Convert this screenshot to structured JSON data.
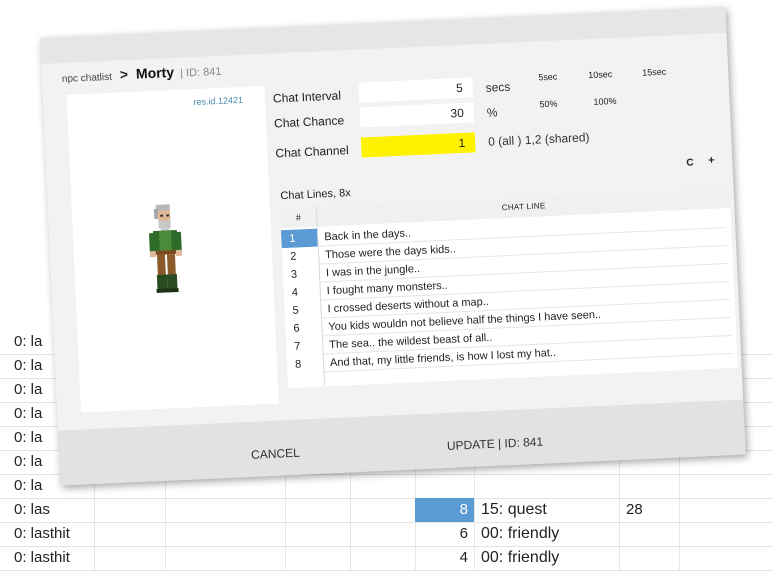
{
  "background_sheet": {
    "rows": [
      {
        "col0": "0: la",
        "num": "",
        "label": "",
        "count": ""
      },
      {
        "col0": "0: la",
        "num": "",
        "label": "",
        "count": ""
      },
      {
        "col0": "0: la",
        "num": "",
        "label": "",
        "count": ""
      },
      {
        "col0": "0: la",
        "num": "",
        "label": "",
        "count": ""
      },
      {
        "col0": "0: la",
        "num": "",
        "label": "",
        "count": ""
      },
      {
        "col0": "0: la",
        "num": "",
        "label": "",
        "count": ""
      },
      {
        "col0": "0: la",
        "num": "",
        "label": "",
        "count": ""
      },
      {
        "col0": "0: las",
        "num": "8",
        "label": "15: quest",
        "count": "28"
      },
      {
        "col0": "0: lasthit",
        "num": "6",
        "label": "00: friendly",
        "count": ""
      },
      {
        "col0": "0: lasthit",
        "num": "4",
        "label": "00: friendly",
        "count": ""
      }
    ],
    "selected_color": "#5b9bd5"
  },
  "dialog": {
    "breadcrumb": {
      "parent": "npc chatlist",
      "separator": ">",
      "name": "Morty",
      "id_text": "| ID: 841"
    },
    "portrait": {
      "res_id": "res.id.12421",
      "sprite_icon": "npc-old-man-sprite"
    },
    "fields": {
      "interval": {
        "label": "Chat Interval",
        "value": "5",
        "unit": "secs"
      },
      "chance": {
        "label": "Chat Chance",
        "value": "30",
        "unit": "%"
      },
      "channel": {
        "label": "Chat Channel",
        "value": "1",
        "hint": "0 (all ) 1,2 (shared)",
        "highlight_color": "#fff200"
      }
    },
    "interval_presets": [
      "5sec",
      "10sec",
      "15sec"
    ],
    "chance_presets": [
      "50%",
      "100%"
    ],
    "chat_lines": {
      "title": "Chat Lines, 8x",
      "c_button": "C",
      "add_button": "+",
      "header_num": "#",
      "header_line": "CHAT LINE",
      "selected_index": 0,
      "rows": [
        {
          "num": "1",
          "text": "Back in the days.."
        },
        {
          "num": "2",
          "text": "Those were the days kids.."
        },
        {
          "num": "3",
          "text": "I was in the jungle.."
        },
        {
          "num": "4",
          "text": "I fought many monsters.."
        },
        {
          "num": "5",
          "text": "I crossed deserts without a map.."
        },
        {
          "num": "6",
          "text": "You kids wouldn not believe half the things I have seen.."
        },
        {
          "num": "7",
          "text": "The sea.. the wildest beast of all.."
        },
        {
          "num": "8",
          "text": "And that, my little friends, is how I lost my hat.."
        }
      ]
    },
    "footer": {
      "cancel_label": "CANCEL",
      "update_label": "UPDATE | ID: 841"
    }
  }
}
